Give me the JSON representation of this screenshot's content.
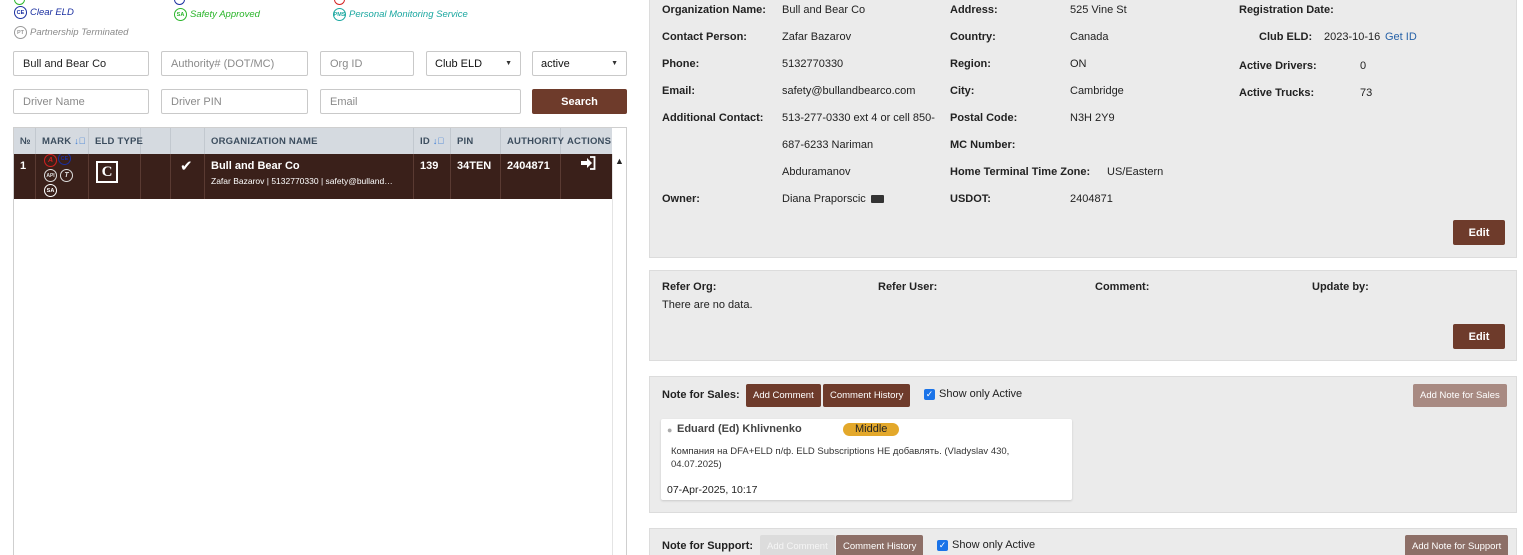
{
  "legend": [
    {
      "abbr": "CE",
      "label": "Clear ELD",
      "color": "#1a2fa0"
    },
    {
      "abbr": "SA",
      "label": "Safety Approved",
      "color": "#2ab52a"
    },
    {
      "abbr": "PMS",
      "label": "Personal Monitoring Service",
      "color": "#1aa7a0"
    },
    {
      "abbr": "PT",
      "label": "Partnership Terminated",
      "color": "#999999"
    }
  ],
  "filters": {
    "org_name_value": "Bull and Bear Co",
    "authority_placeholder": "Authority# (DOT/MC)",
    "org_id_placeholder": "Org ID",
    "eld_select": "Club ELD",
    "status_select": "active",
    "driver_name_placeholder": "Driver Name",
    "driver_pin_placeholder": "Driver PIN",
    "email_placeholder": "Email",
    "search_label": "Search"
  },
  "table": {
    "headers": {
      "num": "№",
      "mark": "MARK",
      "eld_type": "ELD TYPE",
      "org_name": "ORGANIZATION NAME",
      "id": "ID",
      "pin": "PIN",
      "authority": "AUTHORITY",
      "actions": "ACTIONS"
    },
    "rows": [
      {
        "num": "1",
        "eld": "C",
        "name": "Bull and Bear Co",
        "sub": "Zafar Bazarov | 5132770330 | safety@bulland…",
        "id": "139",
        "pin": "34TEN",
        "authority": "2404871"
      }
    ],
    "row_marks": [
      {
        "abbr": "A",
        "color": "#d42020"
      },
      {
        "abbr": "CE",
        "color": "#1a2fa0"
      },
      {
        "abbr": "API",
        "color": "#ffffff"
      },
      {
        "abbr": "T",
        "color": "#ffffff"
      },
      {
        "abbr": "SA",
        "color": "#ffffff"
      }
    ]
  },
  "org": {
    "org_name_label": "Organization Name:",
    "org_name": "Bull and Bear Co",
    "contact_label": "Contact Person:",
    "contact": "Zafar Bazarov",
    "phone_label": "Phone:",
    "phone": "5132770330",
    "email_label": "Email:",
    "email": "safety@bullandbearco.com",
    "add_contact_label": "Additional Contact:",
    "add_contact_1": "513-277-0330 ext 4 or cell 850-",
    "add_contact_2": "687-6233 Nariman",
    "add_contact_3": "Abduramanov",
    "owner_label": "Owner:",
    "owner": "Diana Praporscic",
    "address_label": "Address:",
    "address": "525 Vine St",
    "country_label": "Country:",
    "country": "Canada",
    "region_label": "Region:",
    "region": "ON",
    "city_label": "City:",
    "city": "Cambridge",
    "postal_label": "Postal Code:",
    "postal": "N3H 2Y9",
    "mc_label": "MC Number:",
    "tz_label": "Home Terminal Time Zone:",
    "tz": "US/Eastern",
    "usdot_label": "USDOT:",
    "usdot": "2404871",
    "reg_date_label": "Registration Date:",
    "club_eld_label": "Club ELD:",
    "club_eld": "2023-10-16",
    "get_id": "Get ID",
    "drivers_label": "Active Drivers:",
    "drivers": "0",
    "trucks_label": "Active Trucks:",
    "trucks": "73",
    "edit": "Edit"
  },
  "refer": {
    "org_label": "Refer Org:",
    "user_label": "Refer User:",
    "comment_label": "Comment:",
    "update_label": "Update by:",
    "empty": "There are no data.",
    "edit": "Edit"
  },
  "sales": {
    "title": "Note for Sales:",
    "add_comment": "Add Comment",
    "history": "Comment History",
    "show_active": "Show only Active",
    "add_note": "Add Note for Sales",
    "note": {
      "author": "Eduard (Ed) Khlivnenko",
      "priority": "Middle",
      "text_1": "Компания на DFA+ELD п/ф. ELD Subscriptions НЕ добавлять. (Vladyslav 430,",
      "text_2": "04.07.2025)",
      "date": "07-Apr-2025, 10:17"
    }
  },
  "support": {
    "title": "Note for Support:",
    "add_comment": "Add Comment",
    "history": "Comment History",
    "show_active": "Show only Active",
    "add_note": "Add Note for Support"
  }
}
